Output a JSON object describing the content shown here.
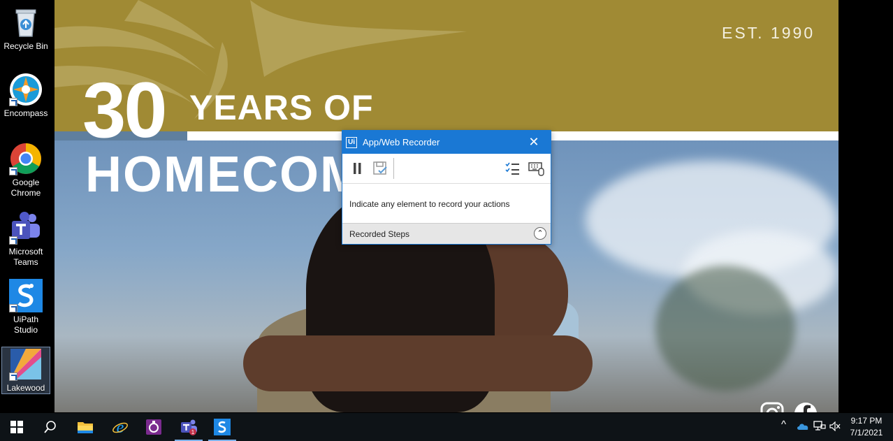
{
  "desktop": {
    "icons": [
      {
        "label": "Recycle Bin",
        "icon": "recycle-bin-icon"
      },
      {
        "label": "Encompass",
        "icon": "encompass-icon"
      },
      {
        "label": "Google Chrome",
        "icon": "chrome-icon"
      },
      {
        "label": "Microsoft Teams",
        "icon": "teams-icon"
      },
      {
        "label": "UiPath Studio",
        "icon": "uipath-studio-icon"
      },
      {
        "label": "Lakewood",
        "icon": "lakewood-icon"
      }
    ]
  },
  "website": {
    "est": "EST. 1990",
    "headline_number": "30",
    "headline_years": "YEARS OF",
    "headline_homecoming": "HOMECOM",
    "social": [
      "instagram-icon",
      "facebook-icon"
    ]
  },
  "recorder": {
    "title": "App/Web Recorder",
    "logo": "Ui",
    "close_glyph": "✕",
    "message": "Indicate any element to record your actions",
    "recorded_steps_label": "Recorded Steps",
    "expand_glyph": "⌃",
    "accent_color": "#1a78d4"
  },
  "taskbar": {
    "pinned": [
      "start-icon",
      "search-icon",
      "file-explorer-icon",
      "internet-explorer-icon",
      "onenote-icon",
      "teams-icon",
      "uipath-studio-icon"
    ],
    "teams_badge": "1",
    "tray_chevron": "^",
    "time": "9:17 PM",
    "date": "7/1/2021"
  }
}
